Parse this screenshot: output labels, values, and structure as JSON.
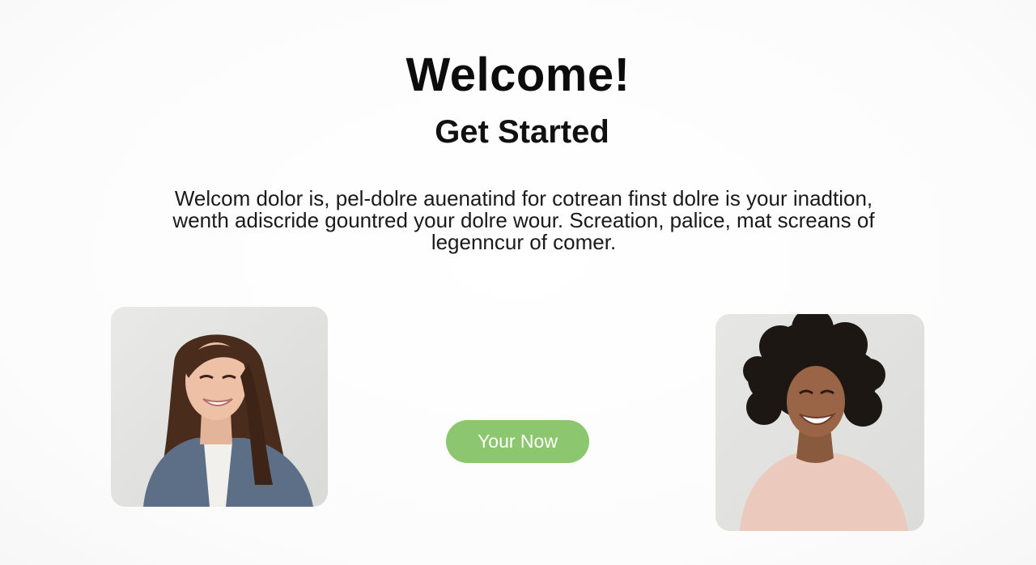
{
  "hero": {
    "title": "Welcome!",
    "subtitle": "Get Started",
    "description": "Welcom dolor is, pel-dolre auenatind for cotrean finst dolre is your inadtion, wenth adiscride gountred your dolre wour. Screation, palice, mat screans of legenncur of comer."
  },
  "cta": {
    "label": "Your Now"
  },
  "colors": {
    "accent": "#8cc66e",
    "background": "#fdfdfd",
    "text": "#111111"
  }
}
